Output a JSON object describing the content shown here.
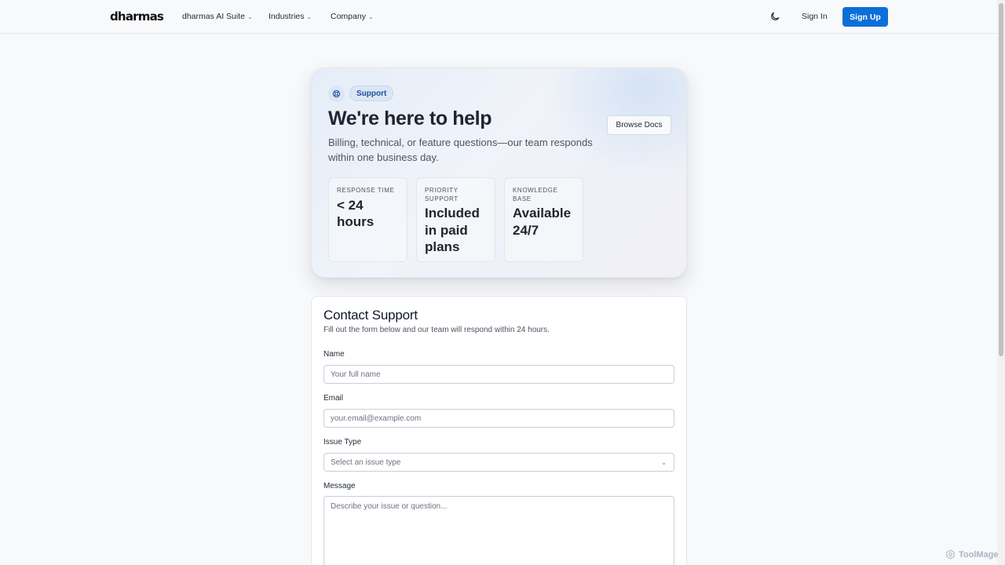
{
  "nav": {
    "logo": "dharmas",
    "items": [
      {
        "label": "dharmas AI Suite"
      },
      {
        "label": "Industries"
      },
      {
        "label": "Company"
      }
    ],
    "sign_in": "Sign In",
    "sign_up": "Sign Up"
  },
  "hero": {
    "badge": "Support",
    "title": "We're here to help",
    "subtitle": "Billing, technical, or feature questions—our team responds within one business day.",
    "browse_docs": "Browse Docs",
    "stats": [
      {
        "label": "RESPONSE TIME",
        "value": "< 24 hours"
      },
      {
        "label": "PRIORITY SUPPORT",
        "value": "Included in paid plans"
      },
      {
        "label": "KNOWLEDGE BASE",
        "value": "Available 24/7"
      }
    ]
  },
  "form": {
    "title": "Contact Support",
    "subtitle": "Fill out the form below and our team will respond within 24 hours.",
    "name_label": "Name",
    "name_placeholder": "Your full name",
    "email_label": "Email",
    "email_placeholder": "your.email@example.com",
    "issue_label": "Issue Type",
    "issue_selected": "Select an issue type",
    "message_label": "Message",
    "message_placeholder": "Describe your issue or question..."
  },
  "watermark": "ToolMage",
  "colors": {
    "primary": "#0b6fd8",
    "badge_bg": "#dbe6f5",
    "badge_text": "#1d4f9a"
  }
}
